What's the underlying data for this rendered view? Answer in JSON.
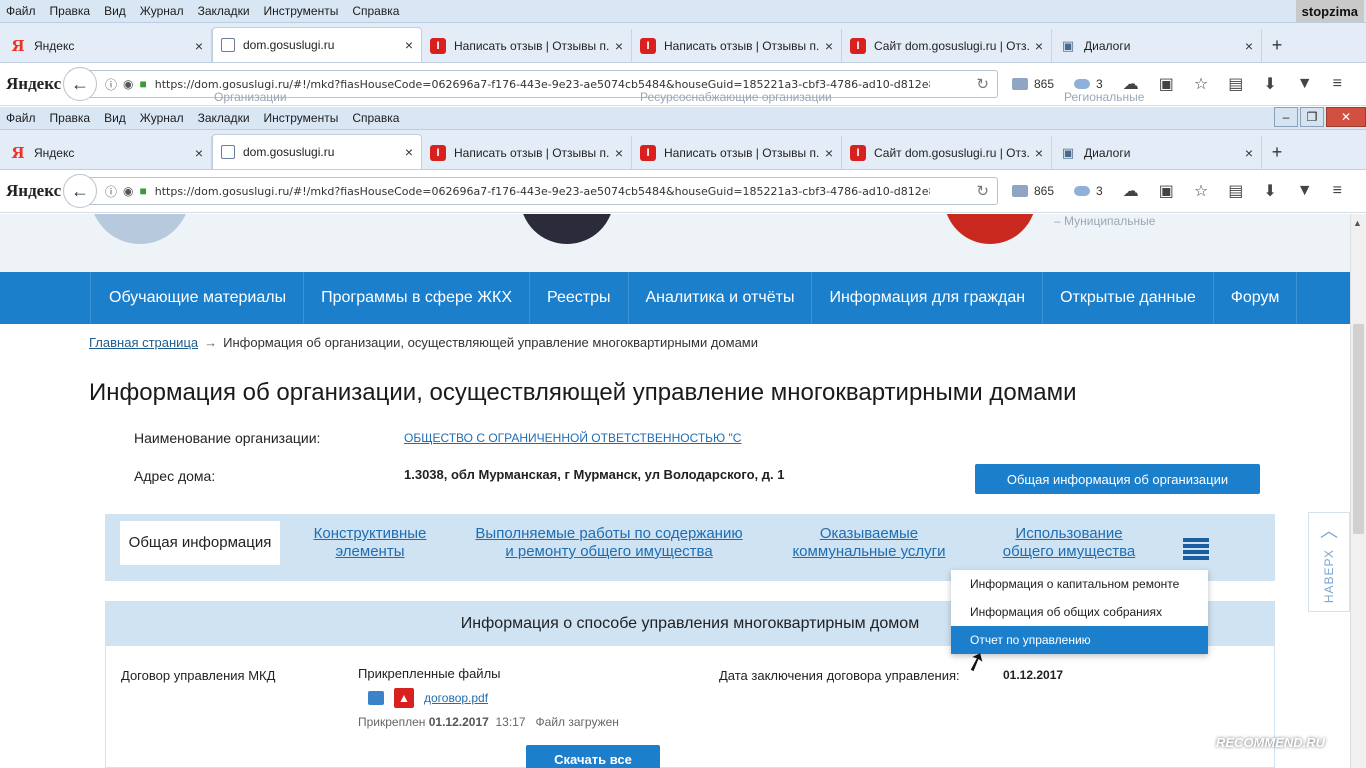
{
  "menu": [
    "Файл",
    "Правка",
    "Вид",
    "Журнал",
    "Закладки",
    "Инструменты",
    "Справка"
  ],
  "tabs": [
    {
      "title": "Яндекс",
      "icon": "yandex-icon"
    },
    {
      "title": "dom.gosuslugi.ru",
      "icon": "gosuslugi-icon"
    },
    {
      "title": "Написать отзыв | Отзывы п...",
      "icon": "irecommend-icon"
    },
    {
      "title": "Написать отзыв | Отзывы п...",
      "icon": "irecommend-icon"
    },
    {
      "title": "Сайт dom.gosuslugi.ru | Отз...",
      "icon": "irecommend-icon"
    },
    {
      "title": "Диалоги",
      "icon": "chat-icon"
    }
  ],
  "browser": {
    "logo": "Яндекс",
    "url": "https://dom.gosuslugi.ru/#!/mkd?fiasHouseCode=062696a7-f176-443e-9e23-ae5074cb5484&houseGuid=185221a3-cbf3-4786-ad10-d812e8fdb34f&orgRootGu",
    "mail_count": "865",
    "weather": "3",
    "username": "stopzima"
  },
  "header_partial": {
    "text1": "Организации",
    "text2": "Ресурсоснабжающие организации",
    "text3": "Региональные",
    "text4": "– Муниципальные"
  },
  "nav": [
    "Обучающие материалы",
    "Программы в сфере ЖКХ",
    "Реестры",
    "Аналитика и отчёты",
    "Информация для граждан",
    "Открытые данные",
    "Форум"
  ],
  "breadcrumb": {
    "home": "Главная страница",
    "arrow": "→",
    "current": "Информация об организации, осуществляющей управление многоквартирными домами"
  },
  "title": "Информация об организации, осуществляющей управление многоквартирными домами",
  "org": {
    "name_label": "Наименование организации:",
    "name_value": "ОБЩЕСТВО С ОГРАНИЧЕННОЙ ОТВЕТСТВЕННОСТЬЮ \"С",
    "address_label": "Адрес дома:",
    "address_value": "1.3038, обл Мурманская, г Мурманск, ул Володарского, д. 1",
    "button": "Общая информация об организации"
  },
  "section_tabs": [
    "Общая информация",
    "Конструктивные элементы",
    "Выполняемые работы по содержанию и ремонту общего имущества",
    "Оказываемые коммунальные услуги",
    "Использование общего имущества"
  ],
  "dropdown": [
    "Информация о капитальном ремонте",
    "Информация об общих собраниях",
    "Отчет по управлению"
  ],
  "section": {
    "heading": "Информация о способе управления многоквартирным домом",
    "contract_label": "Договор управления МКД",
    "files_label": "Прикрепленные файлы",
    "file_name": "договор.pdf",
    "attached_prefix": "Прикреплен",
    "attached_date": "01.12.2017",
    "attached_time": "13:17",
    "attached_status": "Файл загружен",
    "date_label": "Дата заключения договора управления:",
    "date_value": "01.12.2017",
    "download_button": "Скачать все"
  },
  "up_button": "НАВЕРХ",
  "watermark": "RECOMMEND.RU"
}
